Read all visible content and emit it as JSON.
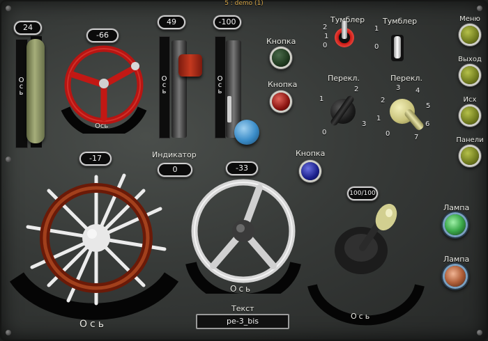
{
  "window": {
    "title": "5 : demo (1)"
  },
  "sliders": [
    {
      "value": "24",
      "axis_label": "Ось"
    },
    {
      "value": "49",
      "axis_label": "Ось"
    },
    {
      "value": "-100",
      "axis_label": "Ось"
    }
  ],
  "small_wheel": {
    "value": "-66",
    "axis_label": "Ось"
  },
  "helm_wheel": {
    "value": "-17",
    "axis_label": "Ось"
  },
  "steering_wheel": {
    "value": "-33",
    "axis_label": "Ось"
  },
  "indicator": {
    "label": "Индикатор",
    "value": "0"
  },
  "buttons": [
    {
      "label": "Кнопка",
      "color": "#1f3a1f"
    },
    {
      "label": "Кнопка",
      "color": "#8a1410"
    },
    {
      "label": "Кнопка",
      "color": "#1a1f8a"
    }
  ],
  "toggles": [
    {
      "label": "Тумблер",
      "positions": [
        "2",
        "1",
        "0"
      ]
    },
    {
      "label": "Тумблер",
      "positions": [
        "1",
        "0"
      ]
    }
  ],
  "selectors": [
    {
      "label": "Перекл.",
      "positions": [
        "0",
        "1",
        "2",
        "3"
      ]
    },
    {
      "label": "Перекл.",
      "positions": [
        "0",
        "1",
        "2",
        "3",
        "4",
        "5",
        "6",
        "7"
      ]
    }
  ],
  "joystick": {
    "value": "100/100",
    "axis_label": "Ось"
  },
  "side_menu": [
    {
      "label": "Меню"
    },
    {
      "label": "Выход"
    },
    {
      "label": "Исх"
    },
    {
      "label": "Панели"
    }
  ],
  "lamps": [
    {
      "label": "Лампа",
      "color": "#3aa84a"
    },
    {
      "label": "Лампа",
      "color": "#b0603a"
    }
  ],
  "text_field": {
    "label": "Текст",
    "value": "ре-3_bis"
  }
}
